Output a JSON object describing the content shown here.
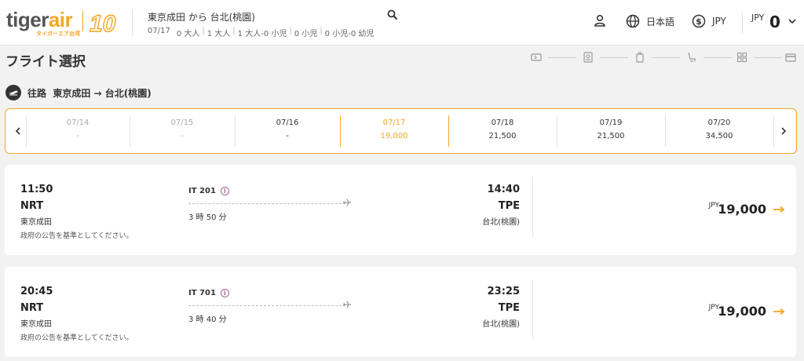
{
  "brand": {
    "logo_text_a": "tiger",
    "logo_text_b": "air",
    "logo_subtitle": "タイガーエア台湾",
    "anniversary": "10"
  },
  "search": {
    "route": "東京成田 から 台北(桃園)",
    "pax": [
      "07/17",
      "0 大人",
      "1 大人",
      "1 大人-0 小児",
      "0 小児",
      "0 小児-0 幼児"
    ]
  },
  "header": {
    "language": "日本語",
    "currency": "JPY",
    "total_currency": "JPY",
    "total_amount": "0"
  },
  "page": {
    "title": "フライト選択",
    "steps": [
      "flight-icon",
      "seat-icon",
      "baggage-icon",
      "seat-select-icon",
      "addons-icon",
      "payment-icon"
    ]
  },
  "outbound": {
    "label": "往路",
    "route": "東京成田 → 台北(桃園)"
  },
  "dates": [
    {
      "date": "07/14",
      "price": "-",
      "state": "disabled"
    },
    {
      "date": "07/15",
      "price": "-",
      "state": "disabled"
    },
    {
      "date": "07/16",
      "price": "-",
      "state": "normal"
    },
    {
      "date": "07/17",
      "price": "19,000",
      "state": "selected"
    },
    {
      "date": "07/18",
      "price": "21,500",
      "state": "normal"
    },
    {
      "date": "07/19",
      "price": "21,500",
      "state": "normal"
    },
    {
      "date": "07/20",
      "price": "34,500",
      "state": "normal"
    }
  ],
  "flights": [
    {
      "dep_time": "11:50",
      "dep_code": "NRT",
      "dep_city": "東京成田",
      "notice": "政府の公告を基準としてください。",
      "flight_no": "IT 201",
      "duration": "3 時 50 分",
      "arr_time": "14:40",
      "arr_code": "TPE",
      "arr_city": "台北(桃園)",
      "currency": "JPY",
      "price": "19,000"
    },
    {
      "dep_time": "20:45",
      "dep_code": "NRT",
      "dep_city": "東京成田",
      "notice": "政府の公告を基準としてください。",
      "flight_no": "IT 701",
      "duration": "3 時 40 分",
      "arr_time": "23:25",
      "arr_code": "TPE",
      "arr_city": "台北(桃園)",
      "currency": "JPY",
      "price": "19,000"
    }
  ],
  "colors": {
    "accent": "#f5a623",
    "info": "#a0679c",
    "text": "#222222"
  }
}
